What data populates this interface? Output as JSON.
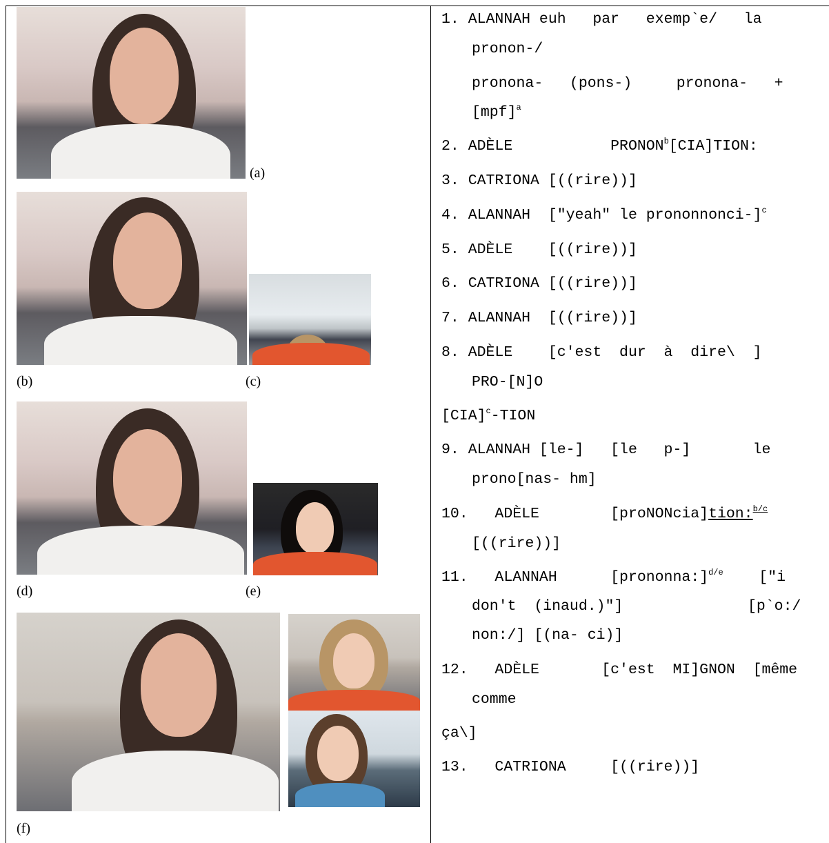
{
  "figure": {
    "captions": {
      "a": "(a)",
      "b": "(b)",
      "c": "(c)",
      "d": "(d)",
      "e": "(e)",
      "f": "(f)"
    }
  },
  "transcript": {
    "l1a": "1. ALANNAH euh   par   exemp`e/   la",
    "l1b": "pronon-/",
    "l1c": "pronona-   (pons-)     pronona-   +",
    "l1d": "[mpf]",
    "l1d_sup": "a",
    "l2_pre": "2. ADÈLE           PRONON",
    "l2_sup": "b",
    "l2_post": "[CIA]TION:",
    "l3": "3. CATRIONA [((rire))]",
    "l4_pre": "4. ALANNAH  [\"yeah\" le prononnonci-]",
    "l4_sup": "c",
    "l5": "5. ADÈLE    [((rire))]",
    "l6": "6. CATRIONA [((rire))]",
    "l7": "7. ALANNAH  [((rire))]",
    "l8a": "8. ADÈLE    [c'est  dur  à  dire\\  ]",
    "l8b": "PRO-[N]O",
    "l8c_pre": "[CIA]",
    "l8c_sup": "c",
    "l8c_post": "-TION",
    "l9a": "9. ALANNAH [le-]   [le   p-]       le",
    "l9b": "prono[nas- hm]",
    "l10a_pre": "10.   ADÈLE        [proNONcia]",
    "l10a_ul": "tion:",
    "l10a_sup": "b/c",
    "l10b": "[((rire))]",
    "l11a_pre": "11.   ALANNAH      [prononna:]",
    "l11a_sup": "d/e",
    "l11a_post": "    [\"i",
    "l11b": "don't  (inaud.)\"]              [p`o:/",
    "l11c": "non:/] [(na- ci)]",
    "l12a": "12.   ADÈLE       [c'est  MI]GNON  [même",
    "l12b": "comme",
    "l12c": "ça\\]",
    "l13": "13.   CATRIONA     [((rire))]"
  }
}
